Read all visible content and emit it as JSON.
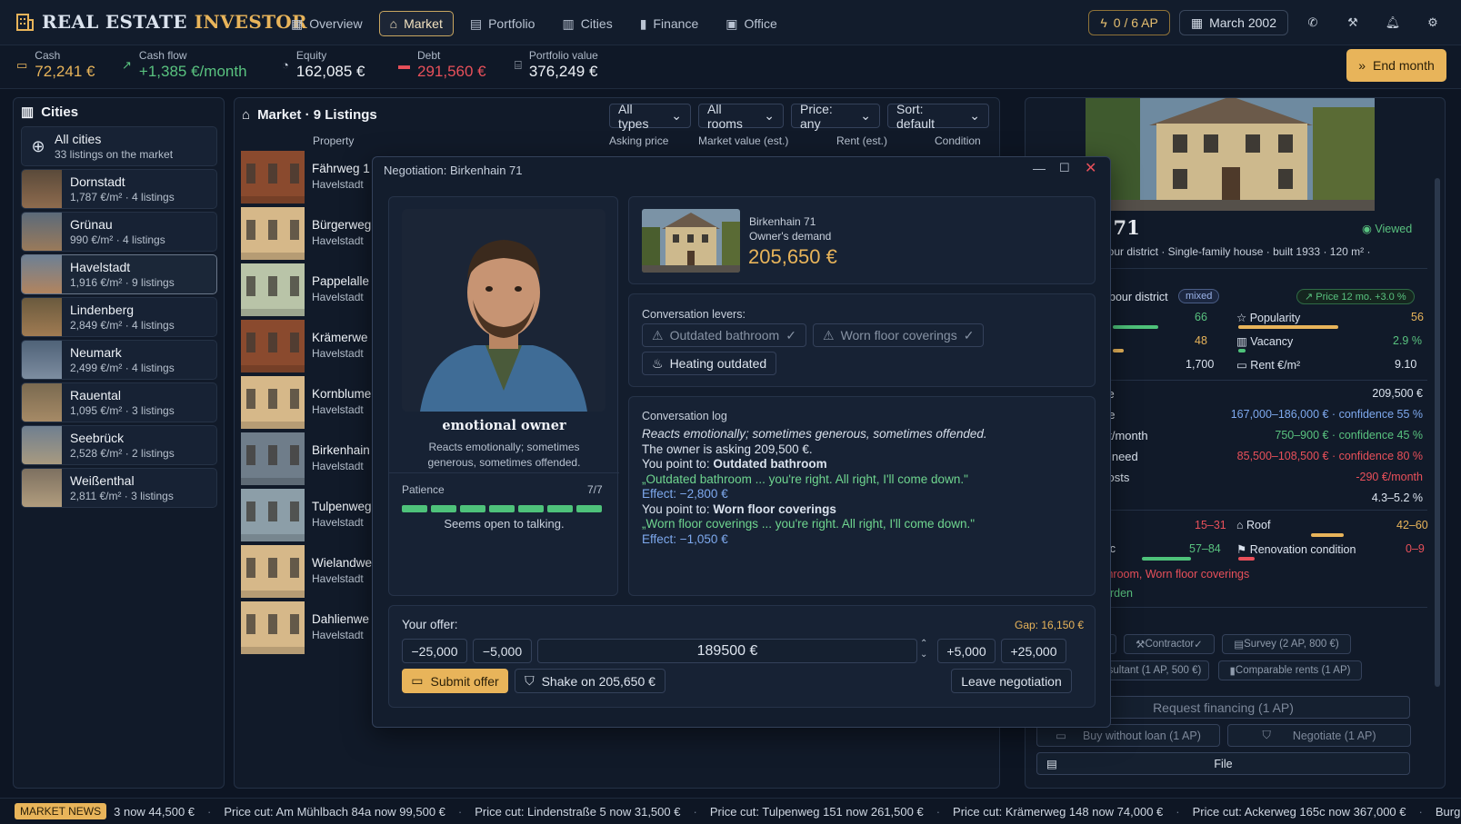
{
  "app": {
    "title_a": "REAL ESTATE",
    "title_b": "INVESTOR"
  },
  "nav": {
    "items": [
      {
        "label": "Overview"
      },
      {
        "label": "Market"
      },
      {
        "label": "Portfolio"
      },
      {
        "label": "Cities"
      },
      {
        "label": "Finance"
      },
      {
        "label": "Office"
      }
    ],
    "active": "Market"
  },
  "top": {
    "ap": "0 / 6 AP",
    "date": "March 2002"
  },
  "stats": {
    "cash_label": "Cash",
    "cash": "72,241 €",
    "cashflow_label": "Cash flow",
    "cashflow": "+1,385 €/month",
    "equity_label": "Equity",
    "equity": "162,085 €",
    "debt_label": "Debt",
    "debt": "291,560 €",
    "portfolio_label": "Portfolio value",
    "portfolio": "376,249 €",
    "end_month": "End month"
  },
  "cities": {
    "title": "Cities",
    "all": {
      "name": "All cities",
      "sub": "33 listings on the market"
    },
    "items": [
      {
        "name": "Dornstadt",
        "sub": "1,787 €/m²  ·  4 listings"
      },
      {
        "name": "Grünau",
        "sub": "990 €/m²  ·  4 listings"
      },
      {
        "name": "Havelstadt",
        "sub": "1,916 €/m²  ·  9 listings"
      },
      {
        "name": "Lindenberg",
        "sub": "2,849 €/m²  ·  4 listings"
      },
      {
        "name": "Neumark",
        "sub": "2,499 €/m²  ·  4 listings"
      },
      {
        "name": "Rauental",
        "sub": "1,095 €/m²  ·  3 listings"
      },
      {
        "name": "Seebrück",
        "sub": "2,528 €/m²  ·  2 listings"
      },
      {
        "name": "Weißenthal",
        "sub": "2,811 €/m²  ·  3 listings"
      }
    ]
  },
  "market": {
    "title": "Market · 9 Listings",
    "filters": [
      "All types",
      "All rooms",
      "Price: any",
      "Sort: default"
    ],
    "cols": [
      "Property",
      "Asking price",
      "Market value (est.)",
      "Rent (est.)",
      "Condition"
    ],
    "listings": [
      {
        "name": "Fährweg 1",
        "city": "Havelstadt"
      },
      {
        "name": "Bürgerweg",
        "city": "Havelstadt"
      },
      {
        "name": "Pappelalle",
        "city": "Havelstadt"
      },
      {
        "name": "Krämerwe",
        "city": "Havelstadt"
      },
      {
        "name": "Kornblume",
        "city": "Havelstadt"
      },
      {
        "name": "Birkenhain",
        "city": "Havelstadt"
      },
      {
        "name": "Tulpenweg",
        "city": "Havelstadt"
      },
      {
        "name": "Wielandwe",
        "city": "Havelstadt"
      },
      {
        "name": "Dahlienwe",
        "city": "Havelstadt"
      }
    ]
  },
  "detail": {
    "title": "in 71",
    "viewed": "Viewed",
    "meta": "rbour district  ·  Single-family house  ·  built 1933  ·  120 m²  ·",
    "district": "bour district",
    "mixed": "mixed",
    "price_trend": "Price 12 mo. +3.0 %",
    "metrics": [
      {
        "label": "Popularity",
        "value": "56"
      },
      {
        "label": "Vacancy",
        "value": "2.9 %"
      },
      {
        "label": "Rent €/m²",
        "value": "9.10"
      }
    ],
    "left_vals": [
      "66",
      "48",
      "1,700"
    ],
    "rows": [
      {
        "k": "ce",
        "v": "209,500 €"
      },
      {
        "k": "ue",
        "v": "167,000–186,000 € · confidence 55 %"
      },
      {
        "k": "nt/month",
        "v": "750–900 € · confidence 45 %"
      },
      {
        "k": "n need",
        "v": "85,500–108,500 € · confidence 80 %"
      },
      {
        "k": "costs",
        "v": "-290 €/month"
      },
      {
        "k": "d",
        "v": "4.3–5.2 %"
      }
    ],
    "cond": [
      {
        "lv": "15–31",
        "label": "Roof",
        "v": "42–60"
      },
      {
        "lk": "ic",
        "lv": "57–84",
        "label": "Renovation condition",
        "v": "0–9"
      }
    ],
    "issues": "throom, Worn floor coverings",
    "garden": "arden",
    "actions": {
      "contractor": "Contractor",
      "survey": "Survey (2 AP, 800 €)",
      "consultant": "sultant (1 AP, 500 €)",
      "comparable": "Comparable rents (1 AP)",
      "financing": "Request financing (1 AP)",
      "buy": "Buy without loan (1 AP)",
      "negotiate": "Negotiate (1 AP)",
      "file": "File"
    }
  },
  "modal": {
    "title": "Negotiation: Birkenhain 71",
    "owner": {
      "type": "emotional owner",
      "desc_1": "Reacts emotionally; sometimes",
      "desc_2": "generous, sometimes offended.",
      "patience_label": "Patience",
      "patience": "7/7",
      "patience_value": 7,
      "patience_max": 7,
      "mood": "Seems open to talking."
    },
    "property": {
      "name": "Birkenhain 71",
      "demand_label": "Owner's demand",
      "demand": "205,650 €"
    },
    "levers": {
      "title": "Conversation levers:",
      "items": [
        {
          "label": "Outdated bathroom",
          "used": true
        },
        {
          "label": "Worn floor coverings",
          "used": true
        },
        {
          "label": "Heating outdated",
          "used": false
        }
      ]
    },
    "log": {
      "title": "Conversation log",
      "l1": "Reacts emotionally; sometimes generous, sometimes offended.",
      "l2": "The owner is asking 209,500 €.",
      "l3a": "You point to: ",
      "l3b": "Outdated bathroom",
      "l4": "„Outdated bathroom ... you're right. All right, I'll come down.\"",
      "l5": "Effect: −2,800 €",
      "l6a": "You point to: ",
      "l6b": "Worn floor coverings",
      "l7": "„Worn floor coverings ... you're right. All right, I'll come down.\"",
      "l8": "Effect: −1,050 €"
    },
    "offer": {
      "label": "Your offer:",
      "gap": "Gap: 16,150 €",
      "m25": "−25,000",
      "m5": "−5,000",
      "value": "189500 €",
      "p5": "+5,000",
      "p25": "+25,000",
      "submit": "Submit offer",
      "shake": "Shake on 205,650 €",
      "leave": "Leave negotiation"
    }
  },
  "ticker": {
    "badge": "MARKET NEWS",
    "items": [
      "3 now 44,500 €",
      "Price cut: Am Mühlbach 84a now 99,500 €",
      "Price cut: Lindenstraße 5 now 31,500 €",
      "Price cut: Tulpenweg 151 now 261,500 €",
      "Price cut: Krämerweg 148 now 74,000 €",
      "Price cut: Ackerweg 165c now 367,000 €",
      "Burglar"
    ]
  },
  "colors": {
    "accent": "#e8b45a",
    "positive": "#59c27f",
    "negative": "#e8505a",
    "info": "#7ea9ee"
  }
}
